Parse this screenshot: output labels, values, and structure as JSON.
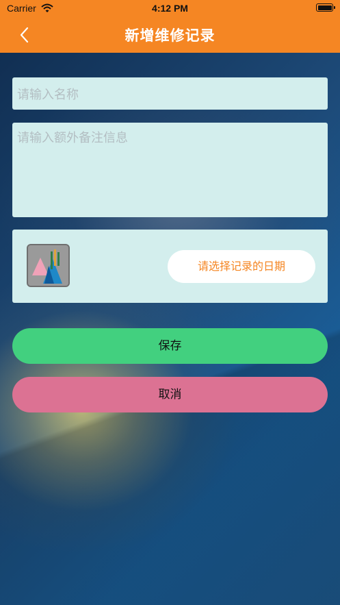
{
  "status_bar": {
    "carrier": "Carrier",
    "time": "4:12 PM"
  },
  "nav": {
    "title": "新增维修记录",
    "back_icon": "chevron-left-icon"
  },
  "form": {
    "name_placeholder": "请输入名称",
    "name_value": "",
    "notes_placeholder": "请输入额外备注信息",
    "notes_value": "",
    "date_button_label": "请选择记录的日期",
    "image_icon": "image-placeholder-icon"
  },
  "actions": {
    "save_label": "保存",
    "cancel_label": "取消"
  },
  "colors": {
    "header": "#f58623",
    "field_bg": "#d3eeed",
    "save": "#42d07f",
    "cancel": "#dc7293",
    "date_text": "#f58623"
  }
}
